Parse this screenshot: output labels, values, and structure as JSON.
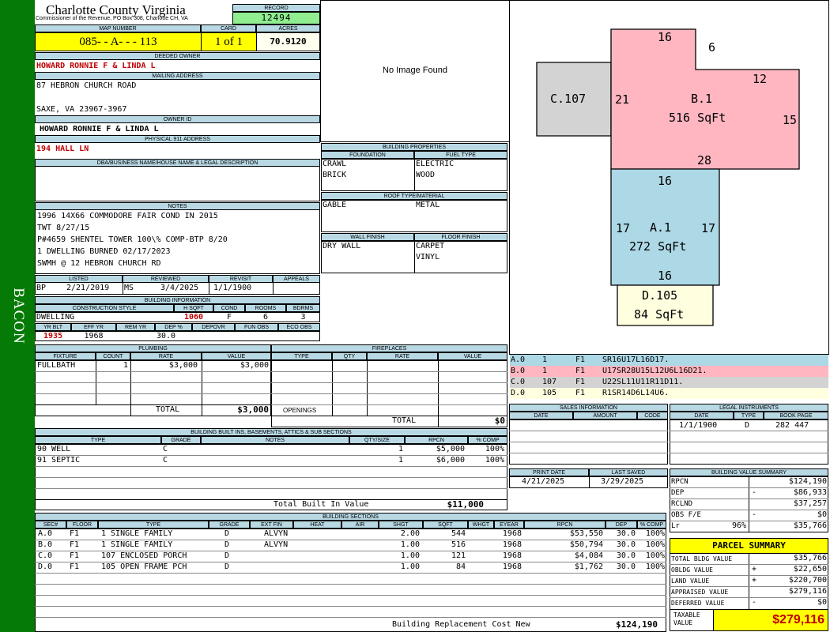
{
  "side_label": "BACON",
  "county": {
    "title": "Charlotte County Virginia",
    "subtitle": "Commissioner of the Revenue, PO Box 308, Charlotte CH, VA"
  },
  "record": {
    "label": "RECORD",
    "value": "12494"
  },
  "map": {
    "label": "MAP NUMBER",
    "value": "085- - A- - - 113",
    "card_label": "CARD",
    "card": "1 of 1",
    "acres_label": "ACRES",
    "acres": "70.9120"
  },
  "owner": {
    "deeded_label": "DEEDED OWNER",
    "deeded": "HOWARD RONNIE F & LINDA L",
    "mailing_label": "MAILING ADDRESS",
    "addr1": "87 HEBRON CHURCH ROAD",
    "addr2": "SAXE, VA 23967-3967",
    "owner_id_label": "OWNER ID",
    "owner_id": "HOWARD RONNIE F & LINDA L",
    "physical_label": "PHYSICAL 911 ADDRESS",
    "physical": "194 HALL LN",
    "dba_label": "DBA/BUSINESS NAME/HOUSE NAME & LEGAL DESCRIPTION"
  },
  "notes": {
    "label": "NOTES",
    "lines": [
      "1996 14X66 COMMODORE FAIR COND IN 2015",
      "TWT 8/27/15",
      "P#4659 SHENTEL TOWER 100\\% COMP-BTP 8/20",
      "1 DWELLING BURNED 02/17/2023",
      "SWMH @ 12 HEBRON CHURCH RD"
    ]
  },
  "dates": {
    "listed_label": "LISTED",
    "listed_code": "BP",
    "listed": "2/21/2019",
    "reviewed_label": "REVIEWED",
    "reviewed_code": "MS",
    "reviewed": "3/4/2025",
    "revisit_label": "REVISIT",
    "revisit": "1/1/1900",
    "appeals_label": "APPEALS"
  },
  "building_info": {
    "label": "BUILDING INFORMATION",
    "h": [
      "CONSTRUCTION STYLE",
      "H SQFT",
      "COND",
      "ROOMS",
      "BDRMS"
    ],
    "v": [
      "DWELLING",
      "1060",
      "F",
      "6",
      "3"
    ],
    "h2": [
      "YR BLT",
      "EFF YR",
      "REM YR",
      "DEP %",
      "DEPOVR",
      "FUN OBS",
      "ECO OBS"
    ],
    "v2": [
      "1935",
      "1968",
      "",
      "30.0",
      "",
      "",
      ""
    ]
  },
  "no_image": "No Image Found",
  "building_props": {
    "label": "BUILDING PROPERTIES",
    "foundation_label": "FOUNDATION",
    "fuel_label": "FUEL TYPE",
    "foundation": [
      "CRAWL",
      "BRICK"
    ],
    "fuel": [
      "ELECTRIC",
      "WOOD"
    ],
    "roof_label": "ROOF TYPE/MATERIAL",
    "roof": "GABLE",
    "roof_mat": "METAL",
    "wall_label": "WALL FINISH",
    "floor_label": "FLOOR FINISH",
    "wall": "DRY WALL",
    "floor": [
      "CARPET",
      "VINYL"
    ]
  },
  "sketch": {
    "b_label": "B.1",
    "b_area": "516 SqFt",
    "a_label": "A.1",
    "a_area": "272 SqFt",
    "c_label": "C.107",
    "d_label": "D.105",
    "d_area": "84 SqFt",
    "dims": {
      "b_top": "16",
      "b_notch": "6",
      "b_step": "12",
      "b_right": "15",
      "b_bottom": "28",
      "b_left": "21",
      "a_top": "16",
      "a_left": "17",
      "a_right": "17",
      "a_bottom": "16"
    }
  },
  "sketch_codes": [
    {
      "id": "A.0",
      "n": "1",
      "f": "F1",
      "code": "SR16U17L16D17.",
      "color": "#add8e6"
    },
    {
      "id": "B.0",
      "n": "1",
      "f": "F1",
      "code": "U17SR28U15L12U6L16D21.",
      "color": "#ffb6c1"
    },
    {
      "id": "C.0",
      "n": "107",
      "f": "F1",
      "code": "U22SL11U11R11D11.",
      "color": "#d3d3d3"
    },
    {
      "id": "D.0",
      "n": "105",
      "f": "F1",
      "code": "R1SR14D6L14U6.",
      "color": "#ffffe0"
    }
  ],
  "plumbing": {
    "label": "PLUMBING",
    "headers": [
      "FIXTURE",
      "COUNT",
      "RATE",
      "VALUE"
    ],
    "rows": [
      [
        "FULLBATH",
        "1",
        "$3,000",
        "$3,000"
      ]
    ],
    "total_label": "TOTAL",
    "total": "$3,000"
  },
  "fireplaces": {
    "label": "FIREPLACES",
    "headers": [
      "TYPE",
      "QTY",
      "RATE",
      "VALUE"
    ],
    "openings_label": "OPENINGS",
    "total_label": "TOTAL",
    "total": "$0"
  },
  "sales": {
    "label": "SALES INFORMATION",
    "headers": [
      "DATE",
      "AMOUNT",
      "CODE"
    ]
  },
  "legal": {
    "label": "LEGAL INSTRUMENTS",
    "headers": [
      "DATE",
      "TYPE",
      "BOOK PAGE"
    ],
    "rows": [
      [
        "1/1/1900",
        "D",
        "282 447"
      ]
    ]
  },
  "print": {
    "print_label": "PRINT DATE",
    "print": "4/21/2025",
    "saved_label": "LAST SAVED",
    "saved": "3/29/2025"
  },
  "builtins": {
    "label": "BUILDING BUILT INS, BASEMENTS, ATTICS & SUB SECTIONS",
    "headers": [
      "TYPE",
      "GRADE",
      "NOTES",
      "QTY/SIZE",
      "RPCN",
      "% COMP"
    ],
    "rows": [
      [
        "90 WELL",
        "C",
        "",
        "1",
        "$5,000",
        "100%"
      ],
      [
        "91 SEPTIC",
        "C",
        "",
        "1",
        "$6,000",
        "100%"
      ]
    ],
    "total_label": "Total Built In Value",
    "total": "$11,000"
  },
  "value_summary": {
    "label": "BUILDING VALUE SUMMARY",
    "rows": [
      {
        "l": "RPCN",
        "s": "",
        "v": "$124,190"
      },
      {
        "l": "DEP",
        "s": "-",
        "v": "$86,933"
      },
      {
        "l": "RCLND",
        "s": "",
        "v": "$37,257"
      },
      {
        "l": "OBS F/E",
        "s": "-",
        "v": "$0"
      },
      {
        "l": "Lr",
        "s": "96%",
        "v": "$35,766"
      }
    ]
  },
  "parcel": {
    "label": "PARCEL SUMMARY",
    "rows": [
      {
        "l": "TOTAL BLDG VALUE",
        "s": "",
        "v": "$35,766"
      },
      {
        "l": "OBLDG VALUE",
        "s": "+",
        "v": "$22,650"
      },
      {
        "l": "LAND VALUE",
        "s": "+",
        "v": "$220,700"
      },
      {
        "l": "APPRAISED VALUE",
        "s": "",
        "v": "$279,116"
      },
      {
        "l": "DEFERRED VALUE",
        "s": "-",
        "v": "$0"
      }
    ],
    "taxable_label": "TAXABLE VALUE",
    "taxable": "$279,116"
  },
  "sections": {
    "label": "BUILDING SECTIONS",
    "headers": [
      "SEC#",
      "FLOOR",
      "TYPE",
      "GRADE",
      "EXT FIN",
      "HEAT",
      "AIR",
      "SHGT",
      "SQFT",
      "WHGT",
      "EYEAR",
      "RPCN",
      "DEP",
      "% COMP"
    ],
    "rows": [
      [
        "A.0",
        "F1",
        "1 SINGLE FAMILY",
        "D",
        "ALVYN",
        "",
        "",
        "2.00",
        "544",
        "",
        "1968",
        "$53,550",
        "30.0",
        "100%"
      ],
      [
        "B.0",
        "F1",
        "1 SINGLE FAMILY",
        "D",
        "ALVYN",
        "",
        "",
        "1.00",
        "516",
        "",
        "1968",
        "$50,794",
        "30.0",
        "100%"
      ],
      [
        "C.0",
        "F1",
        "107 ENCLOSED PORCH",
        "D",
        "",
        "",
        "",
        "1.00",
        "121",
        "",
        "1968",
        "$4,084",
        "30.0",
        "100%"
      ],
      [
        "D.0",
        "F1",
        "105 OPEN FRAME PCH",
        "D",
        "",
        "",
        "",
        "1.00",
        "84",
        "",
        "1968",
        "$1,762",
        "30.0",
        "100%"
      ]
    ],
    "total_label": "Building Replacement Cost New",
    "total": "$124,190"
  }
}
